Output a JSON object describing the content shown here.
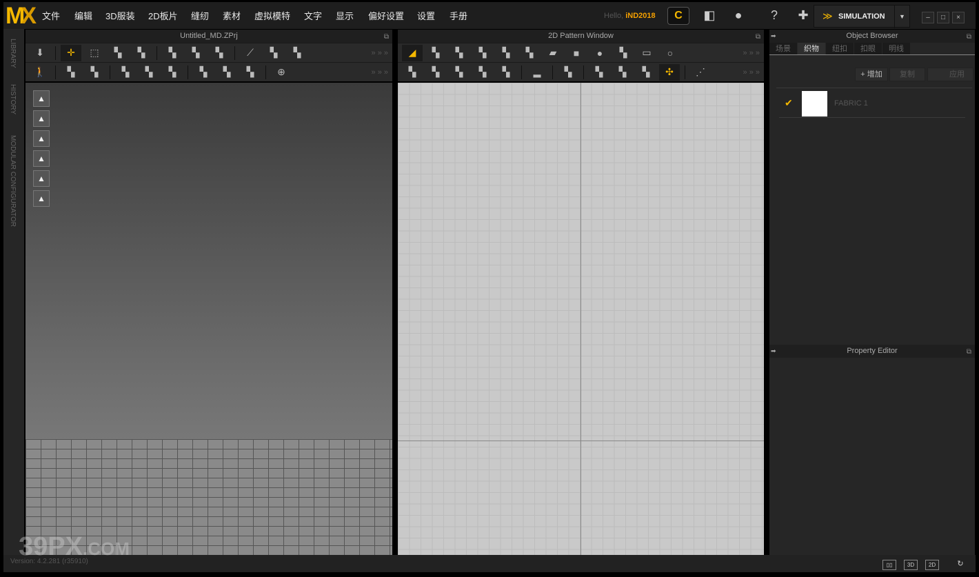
{
  "app": {
    "logo": "MD",
    "menu": [
      "文件",
      "编辑",
      "3D服装",
      "2D板片",
      "缝纫",
      "素材",
      "虚拟模特",
      "文字",
      "显示",
      "偏好设置",
      "设置",
      "手册"
    ],
    "greeting": "Hello,",
    "user": "iND2018",
    "mode": "SIMULATION",
    "accent": "#f5b800"
  },
  "sidebar": [
    "LIBRARY",
    "HISTORY",
    "MODULAR CONFIGURATOR"
  ],
  "panel3d": {
    "title": "Untitled_MD.ZPrj",
    "row1": [
      "avatar-down-icon",
      "|",
      "transform-move-icon",
      "select-box-icon",
      "select-point-icon",
      "box-select-icon",
      "|",
      "segment-sew-icon",
      "free-sew-icon",
      "m-n-sew-icon",
      "|",
      "pin-icon",
      "fold-arrange-icon",
      "tack-icon"
    ],
    "row2": [
      "walk-avatar-icon",
      "|",
      "draw-internal-icon",
      "edit-internal-icon",
      "|",
      "draw-curve-icon",
      "edit-curve-icon",
      "garment-layer-icon",
      "|",
      "texture-edit-icon",
      "graphic-icon",
      "fabric-pattern-icon",
      "|",
      "button-icon"
    ],
    "side_tools": [
      "shirt-front-icon",
      "shirt-back-icon",
      "avatar-icon",
      "fold-icon",
      "fabric-icon",
      "head-icon"
    ]
  },
  "panel2d": {
    "title": "2D Pattern Window",
    "row1": [
      "edit-pattern-icon",
      "edit-point-icon",
      "edit-curve-point-icon",
      "add-point-icon",
      "add-curve-icon",
      "internal-line-icon",
      "polygon-icon",
      "rectangle-icon",
      "ellipse-icon",
      "internal-polygon-icon",
      "internal-rect-icon",
      "internal-circle-icon"
    ],
    "row2": [
      "segment-sew-icon",
      "free-sew-icon",
      "m-n-sew-icon",
      "check-sew-icon",
      "tack-icon",
      "|",
      "ironing-icon",
      "|",
      "pattern-layout-icon",
      "|",
      "texture-edit-icon",
      "graphic-icon",
      "fabric-pattern-icon",
      "visibility-icon",
      "|",
      "tape-icon"
    ]
  },
  "object_browser": {
    "title": "Object Browser",
    "tabs": [
      "场景",
      "织物",
      "纽扣",
      "扣眼",
      "明线"
    ],
    "selected_tab": 1,
    "buttons": [
      "+ 增加",
      "复制",
      "应用"
    ],
    "items": [
      {
        "name": "FABRIC 1",
        "checked": true,
        "color": "#ffffff"
      }
    ]
  },
  "property_editor": {
    "title": "Property Editor"
  },
  "status": {
    "version": "Version: 4.2.281 (r35910)",
    "view_buttons": [
      "single-view",
      "3D",
      "2D"
    ]
  },
  "watermark": "39PX.COM"
}
